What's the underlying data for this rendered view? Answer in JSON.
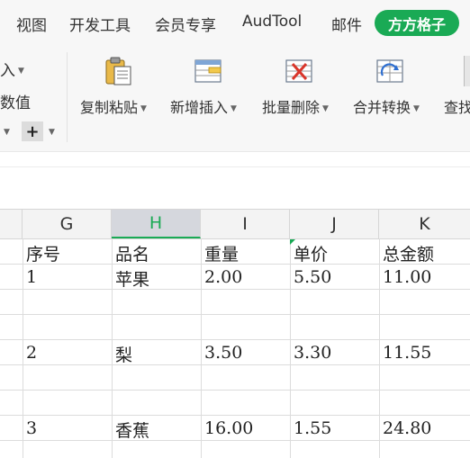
{
  "menubar": {
    "items": [
      "视图",
      "开发工具",
      "会员专享",
      "AudTool",
      "邮件"
    ],
    "active_tab": "方方格子"
  },
  "ribbon": {
    "left": {
      "partial_label_1": "入",
      "partial_label_2": "数值"
    },
    "tools": [
      {
        "label": "复制粘贴",
        "icon": "clipboard-icon"
      },
      {
        "label": "新增插入",
        "icon": "insert-row-icon"
      },
      {
        "label": "批量删除",
        "icon": "delete-table-icon"
      },
      {
        "label": "合并转换",
        "icon": "merge-convert-icon"
      },
      {
        "label": "查找",
        "icon": "find-icon"
      }
    ]
  },
  "sheet": {
    "columns": [
      "G",
      "H",
      "I",
      "J",
      "K"
    ],
    "selected_column": "H",
    "header_row": [
      "序号",
      "品名",
      "重量",
      "单价",
      "总金额"
    ],
    "rows": [
      [
        "1",
        "苹果",
        "2.00",
        "5.50",
        "11.00"
      ],
      [
        "2",
        "梨",
        "3.50",
        "3.30",
        "11.55"
      ],
      [
        "3",
        "香蕉",
        "16.00",
        "1.55",
        "24.80"
      ]
    ]
  },
  "colors": {
    "accent": "#1aaa55",
    "header_bg": "#f3f3f3",
    "selected_header_bg": "#d5d7dd"
  }
}
